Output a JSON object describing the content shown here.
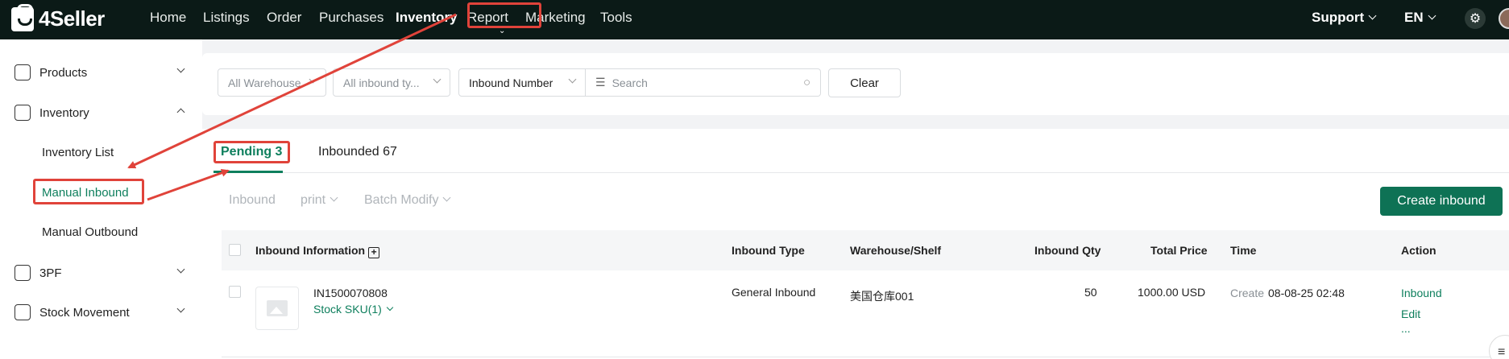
{
  "brand": {
    "name": "4Seller"
  },
  "nav": {
    "items": [
      "Home",
      "Listings",
      "Order",
      "Purchases",
      "Inventory",
      "Report",
      "Marketing",
      "Tools"
    ],
    "active": "Inventory",
    "support": "Support",
    "language": "EN"
  },
  "sidebar": {
    "groups": [
      {
        "label": "Products",
        "icon": "products-icon",
        "expanded": false
      },
      {
        "label": "Inventory",
        "icon": "inventory-icon",
        "expanded": true
      },
      {
        "label": "3PF",
        "icon": "3pf-icon",
        "expanded": false
      },
      {
        "label": "Stock Movement",
        "icon": "stock-movement-icon",
        "expanded": false
      }
    ],
    "inventory_items": [
      "Inventory List",
      "Manual Inbound",
      "Manual Outbound"
    ],
    "active_item": "Manual Inbound"
  },
  "filters": {
    "warehouse": "All Warehouse",
    "inbound_type": "All inbound ty...",
    "search_field": "Inbound Number",
    "search_placeholder": "Search",
    "clear_label": "Clear"
  },
  "tabs": [
    {
      "label": "Pending 3",
      "active": true
    },
    {
      "label": "Inbounded 67",
      "active": false
    }
  ],
  "toolbar": {
    "inbound": "Inbound",
    "print": "print",
    "batch_modify": "Batch Modify",
    "create": "Create inbound"
  },
  "table": {
    "columns": [
      "Inbound Information",
      "Inbound Type",
      "Warehouse/Shelf",
      "Inbound Qty",
      "Total Price",
      "Time",
      "Action"
    ],
    "rows": [
      {
        "inbound_number": "IN1500070808",
        "sku_link": "Stock SKU(1)",
        "inbound_type": "General Inbound",
        "warehouse": "美国仓库001",
        "qty": "50",
        "total_price": "1000.00 USD",
        "time_label": "Create",
        "time_value": "08-08-25 02:48",
        "actions": [
          "Inbound",
          "Edit",
          "..."
        ]
      }
    ]
  },
  "colors": {
    "topbar": "#0b1a17",
    "accent": "#0e7f5d",
    "annotation": "#e0433a"
  }
}
